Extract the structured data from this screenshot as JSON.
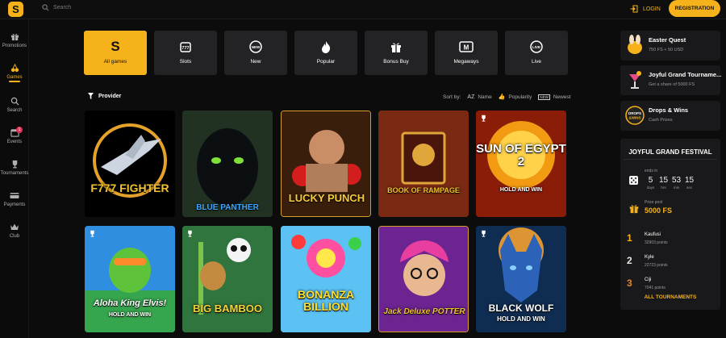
{
  "header": {
    "search_placeholder": "Search",
    "login_label": "LOGIN",
    "registration_label": "REGISTRATION",
    "logo_letter": "S",
    "accent_color": "#f6b21a"
  },
  "sidebar": {
    "items": [
      {
        "label": "Promotions",
        "icon": "gift-icon"
      },
      {
        "label": "Games",
        "icon": "cherries-icon",
        "active": true
      },
      {
        "label": "Search",
        "icon": "search-icon"
      },
      {
        "label": "Events",
        "icon": "calendar-icon",
        "badge": "1"
      },
      {
        "label": "Tournaments",
        "icon": "trophy-icon"
      },
      {
        "label": "Payments",
        "icon": "card-icon"
      },
      {
        "label": "Club",
        "icon": "crown-icon"
      }
    ]
  },
  "categories": [
    {
      "label": "All games",
      "icon": "logo-s-icon",
      "active": true
    },
    {
      "label": "Slots",
      "icon": "slot-machine-icon"
    },
    {
      "label": "New",
      "icon": "new-badge-icon"
    },
    {
      "label": "Popular",
      "icon": "fire-icon"
    },
    {
      "label": "Bonus Buy",
      "icon": "gift-box-icon"
    },
    {
      "label": "Megaways",
      "icon": "megaways-icon"
    },
    {
      "label": "Live",
      "icon": "live-icon"
    }
  ],
  "filters": {
    "provider_label": "Provider",
    "sort_by_label": "Sort by:",
    "sort_options": [
      {
        "glyph": "AZ",
        "label": "Name"
      },
      {
        "glyph": "👍",
        "label": "Popularity"
      },
      {
        "glyph": "NEW",
        "label": "Newest"
      }
    ]
  },
  "games": [
    {
      "title": "F777 FIGHTER",
      "trophy": false
    },
    {
      "title": "BLUE PANTHER",
      "trophy": false
    },
    {
      "title": "LUCKY PUNCH",
      "trophy": false
    },
    {
      "title": "BOOK OF RAMPAGE",
      "trophy": false
    },
    {
      "title": "SUN OF EGYPT 2",
      "subtitle": "HOLD AND WIN",
      "trophy": true
    },
    {
      "title": "Aloha King Elvis!",
      "subtitle": "HOLD AND WIN",
      "trophy": true
    },
    {
      "title": "BIG BAMBOO",
      "trophy": true
    },
    {
      "title": "BONANZA BILLION",
      "trophy": false
    },
    {
      "title": "Jack Deluxe POTTER",
      "trophy": false
    },
    {
      "title": "BLACK WOLF",
      "subtitle": "HOLD AND WIN",
      "trophy": true
    }
  ],
  "promos": [
    {
      "title": "Easter Quest",
      "subtitle": "750 FS + 50 USD"
    },
    {
      "title": "Joyful Grand Tourname...",
      "subtitle": "Get a share of 5000 FS"
    },
    {
      "title": "Drops & Wins",
      "subtitle": "Cash Prizes"
    }
  ],
  "festival": {
    "title": "JOYFUL GRAND FESTIVAL",
    "ends_label": "ends in",
    "timer": [
      {
        "value": "5",
        "unit": "days"
      },
      {
        "value": "15",
        "unit": "hrs"
      },
      {
        "value": "53",
        "unit": "min"
      },
      {
        "value": "15",
        "unit": "sec"
      }
    ],
    "prize_pool_label": "Prize pool",
    "prize_pool_value": "5000 FS",
    "leaders": [
      {
        "rank": "1",
        "name": "Kaufusi",
        "points": "32903 points"
      },
      {
        "rank": "2",
        "name": "Kyle",
        "points": "22723 points"
      },
      {
        "rank": "3",
        "name": "Ciji",
        "points": "7041 points"
      }
    ],
    "all_tournaments_label": "ALL TOURNAMENTS"
  }
}
